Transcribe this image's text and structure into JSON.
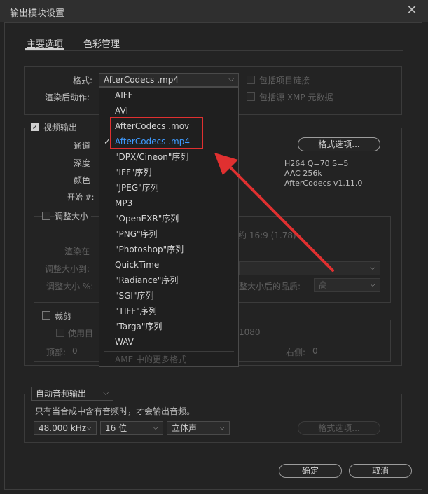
{
  "window": {
    "title": "输出模块设置",
    "close_glyph": "✕"
  },
  "tabs": [
    {
      "label": "主要选项"
    },
    {
      "label": "色彩管理"
    }
  ],
  "format_section": {
    "format_label": "格式:",
    "format_value": "AfterCodecs .mp4",
    "post_render_label": "渲染后动作:",
    "include_project_link": "包括项目链接",
    "include_source_xmp": "包括源 XMP 元数据"
  },
  "format_menu": {
    "options": [
      "AIFF",
      "AVI",
      "AfterCodecs .mov",
      "AfterCodecs .mp4",
      "\"DPX/Cineon\"序列",
      "\"IFF\"序列",
      "\"JPEG\"序列",
      "MP3",
      "\"OpenEXR\"序列",
      "\"PNG\"序列",
      "\"Photoshop\"序列",
      "QuickTime",
      "\"Radiance\"序列",
      "\"SGI\"序列",
      "\"TIFF\"序列",
      "\"Targa\"序列",
      "WAV"
    ],
    "selected": "AfterCodecs .mp4",
    "more_formats": "AME 中的更多格式"
  },
  "video_output": {
    "label": "视频输出",
    "channels_label": "通道",
    "depth_label": "深度",
    "color_label": "颜色",
    "start_label": "开始 #:",
    "format_options_button": "格式选项...",
    "info_lines": [
      "H264 Q=70 S=5",
      "AAC 256k",
      "AfterCodecs v1.11.0"
    ]
  },
  "resize": {
    "label": "调整大小",
    "aspect_text": "约 16:9 (1.78)",
    "render_in_label": "渲染在",
    "resize_to_label": "调整大小到:",
    "resize_pct_label": "调整大小 %:",
    "quality_label": "整大小后的品质:",
    "quality_value": "高"
  },
  "crop": {
    "label": "裁剪",
    "use_roi_label": "使用目",
    "size_text": "1080",
    "top_label": "顶部:",
    "top_value": "0",
    "right_label": "右侧:",
    "right_value": "0"
  },
  "audio": {
    "mode_value": "自动音频输出",
    "note": "只有当合成中含有音频时，才会输出音频。",
    "sample_rate": "48.000 kHz",
    "bit_depth": "16 位",
    "channels": "立体声",
    "format_options_button": "格式选项..."
  },
  "footer": {
    "ok_button": "确定",
    "cancel_button": "取消"
  },
  "colors": {
    "accent": "#3f9bff",
    "highlight_box": "#e03030",
    "arrow": "#e03030"
  }
}
